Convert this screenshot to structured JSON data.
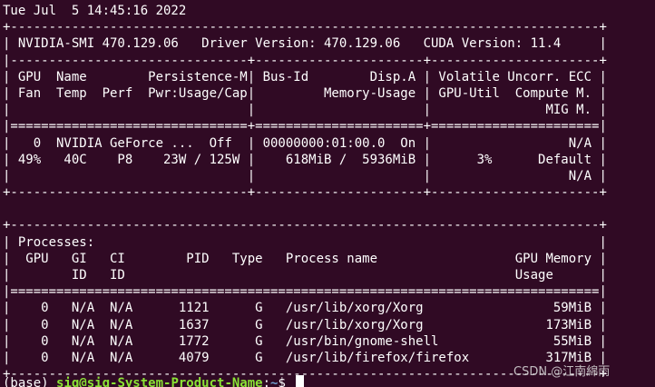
{
  "terminal": {
    "lines": [
      "Tue Jul  5 14:45:16 2022",
      "+-----------------------------------------------------------------------------+",
      "| NVIDIA-SMI 470.129.06   Driver Version: 470.129.06   CUDA Version: 11.4     |",
      "|-------------------------------+----------------------+----------------------+",
      "| GPU  Name        Persistence-M| Bus-Id        Disp.A | Volatile Uncorr. ECC |",
      "| Fan  Temp  Perf  Pwr:Usage/Cap|         Memory-Usage | GPU-Util  Compute M. |",
      "|                               |                      |               MIG M. |",
      "|===============================+======================+======================|",
      "|   0  NVIDIA GeForce ...  Off  | 00000000:01:00.0  On |                  N/A |",
      "| 49%   40C    P8    23W / 125W |    618MiB /  5936MiB |      3%      Default |",
      "|                               |                      |                  N/A |",
      "+-------------------------------+----------------------+----------------------+",
      "",
      "+-----------------------------------------------------------------------------+",
      "| Processes:                                                                  |",
      "|  GPU   GI   CI        PID   Type   Process name                  GPU Memory |",
      "|        ID   ID                                                   Usage      |",
      "|=============================================================================|",
      "|    0   N/A  N/A      1121      G   /usr/lib/xorg/Xorg                 59MiB |",
      "|    0   N/A  N/A      1637      G   /usr/lib/xorg/Xorg                173MiB |",
      "|    0   N/A  N/A      1772      G   /usr/bin/gnome-shell               55MiB |",
      "|    0   N/A  N/A      4079      G   /usr/lib/firefox/firefox          317MiB |",
      "+-----------------------------------------------------------------------------+"
    ],
    "prompt": {
      "env": "(base) ",
      "user_host": "sig@sig-System-Product-Name",
      "separator": ":",
      "path": "~",
      "symbol": "$ "
    }
  },
  "watermark": "CSDN @江南綿雨"
}
